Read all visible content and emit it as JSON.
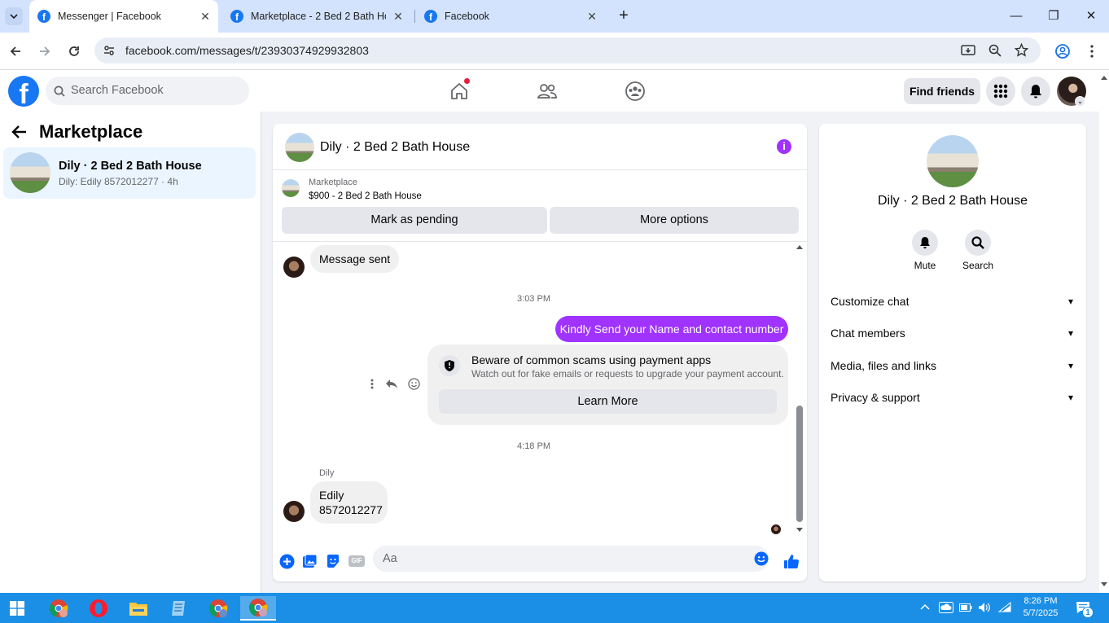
{
  "browser": {
    "tabs": [
      {
        "title": "Messenger | Facebook",
        "active": true
      },
      {
        "title": "Marketplace - 2 Bed 2 Bath Hou",
        "active": false
      },
      {
        "title": "Facebook",
        "active": false
      }
    ],
    "url": "facebook.com/messages/t/23930374929932803"
  },
  "fb_header": {
    "search_placeholder": "Search Facebook",
    "find_friends": "Find friends"
  },
  "left_panel": {
    "title": "Marketplace",
    "conversation": {
      "name": "Dily · 2 Bed 2 Bath House",
      "subtitle": "Dily: Edily 8572012277 · 4h"
    }
  },
  "chat": {
    "header_name": "Dily · 2 Bed 2 Bath House",
    "marketplace_label": "Marketplace",
    "listing": "$900 - 2 Bed 2 Bath House",
    "mark_pending": "Mark as pending",
    "more_options": "More options",
    "messages": {
      "sent_notice": "Message sent",
      "time1": "3:03 PM",
      "outgoing": "Kindly Send your Name and contact number",
      "scam_title": "Beware of common scams using payment apps",
      "scam_sub": "Watch out for fake emails or requests to upgrade your payment account.",
      "learn_more": "Learn More",
      "time2": "4:18 PM",
      "sender": "Dily",
      "incoming_line1": "Edily",
      "incoming_line2": "8572012277"
    },
    "composer_placeholder": "Aa",
    "composer_gif": "GIF"
  },
  "right_panel": {
    "name": "Dily · 2 Bed 2 Bath House",
    "mute": "Mute",
    "search": "Search",
    "sections": [
      "Customize chat",
      "Chat members",
      "Media, files and links",
      "Privacy & support"
    ]
  },
  "taskbar": {
    "time": "8:26 PM",
    "date": "5/7/2025",
    "notification_count": "1"
  },
  "colors": {
    "messenger_purple": "#a033ff",
    "facebook_blue": "#1877f2",
    "taskbar_blue": "#1b8fe6"
  }
}
